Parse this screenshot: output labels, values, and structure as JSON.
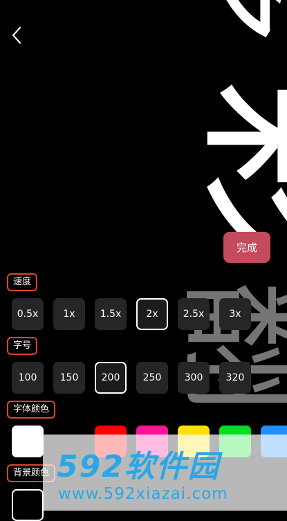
{
  "top": {
    "back_icon": "chevron-left-icon"
  },
  "preview": {
    "chars": [
      "多",
      "彩",
      "翻"
    ],
    "main_color": "#ffffff",
    "ghost_color": "#808080"
  },
  "done_button": {
    "label": "完成",
    "color": "#c44a5c"
  },
  "speed": {
    "label": "速度",
    "options": [
      "0.5x",
      "1x",
      "1.5x",
      "2x",
      "2.5x",
      "3x"
    ],
    "selected": "2x"
  },
  "font_size": {
    "label": "字号",
    "options": [
      "100",
      "150",
      "200",
      "250",
      "300",
      "320"
    ],
    "selected": "200"
  },
  "font_color": {
    "label": "字体颜色",
    "colors": [
      "#ffffff",
      "#ff0000",
      "#ff1493",
      "#ffe000",
      "#00e020",
      "#1e90ff"
    ],
    "selected": "#ffffff"
  },
  "bg_color": {
    "label": "背景颜色",
    "colors": [
      "#000000"
    ],
    "selected": "#000000"
  },
  "watermark": {
    "title": "592软件园",
    "url": "www.592xiazai.com"
  }
}
